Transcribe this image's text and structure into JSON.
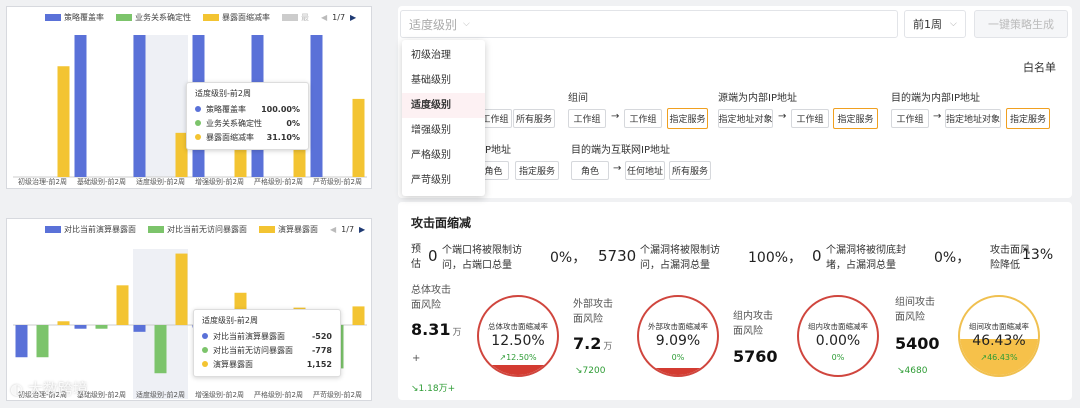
{
  "chart_data": [
    {
      "type": "bar",
      "categories": [
        "初级治理-前2周",
        "基础级别-前2周",
        "适度级别-前2周",
        "增强级别-前2周",
        "严格级别-前2周",
        "严苛级别-前2周"
      ],
      "series": [
        {
          "name": "策略覆盖率",
          "color": "#5a71d8",
          "values": [
            0,
            100,
            100,
            100,
            100,
            100
          ]
        },
        {
          "name": "业务关系确定性",
          "color": "#7cc46b",
          "values": [
            0,
            0,
            0,
            0,
            0,
            0
          ]
        },
        {
          "name": "暴露面缩减率",
          "color": "#f3c432",
          "values": [
            78,
            0,
            31.1,
            48,
            58,
            55
          ]
        }
      ],
      "legend_extra": "最",
      "page": "1/7",
      "tooltip": {
        "title": "适度级别-前2周",
        "rows": [
          {
            "name": "策略覆盖率",
            "value": "100.00%"
          },
          {
            "name": "业务关系确定性",
            "value": "0%"
          },
          {
            "name": "暴露面缩减率",
            "value": "31.10%"
          }
        ]
      }
    },
    {
      "type": "bar",
      "categories": [
        "初级治理-前2周",
        "基础级别-前2周",
        "适度级别-前2周",
        "增强级别-前2周",
        "严格级别-前2周",
        "严苛级别-前2周"
      ],
      "series": [
        {
          "name": "对比当前演算暴露面",
          "color": "#5a71d8",
          "values": [
            -520,
            -60,
            -110,
            -40,
            -50,
            -70
          ]
        },
        {
          "name": "对比当前无访问暴露面",
          "color": "#7cc46b",
          "values": [
            -520,
            -60,
            -778,
            -40,
            -60,
            -700
          ]
        },
        {
          "name": "演算暴露面",
          "color": "#f3c432",
          "values": [
            60,
            640,
            1152,
            520,
            280,
            300
          ]
        }
      ],
      "legend_extra": "",
      "page": "1/7",
      "tooltip": {
        "title": "适度级别-前2周",
        "rows": [
          {
            "name": "对比当前演算暴露面",
            "value": "-520"
          },
          {
            "name": "对比当前无访问暴露面",
            "value": "-778"
          },
          {
            "name": "演算暴露面",
            "value": "1,152"
          }
        ]
      }
    }
  ],
  "toolbar": {
    "level_placeholder": "适度级别",
    "period": "前1周",
    "generate_label": "一键策略生成"
  },
  "dropdown": {
    "items": [
      "初级治理",
      "基础级别",
      "适度级别",
      "增强级别",
      "严格级别",
      "严苛级别"
    ],
    "selected": "适度级别"
  },
  "policy": {
    "whitelist": "白名单",
    "groups": [
      {
        "title": "",
        "chips": [
          {
            "text": "工作组"
          },
          {
            "text": "所有服务"
          }
        ]
      },
      {
        "title": "组间",
        "chips": [
          {
            "text": "工作组"
          },
          {
            "text": "工作组"
          },
          {
            "text": "指定服务",
            "hl": true
          }
        ]
      },
      {
        "title": "源端为内部IP地址",
        "chips": [
          {
            "text": "指定地址对象"
          },
          {
            "text": "工作组"
          },
          {
            "text": "指定服务",
            "hl": true
          }
        ]
      },
      {
        "title": "目的端为内部IP地址",
        "chips": [
          {
            "text": "工作组"
          },
          {
            "text": "指定地址对象"
          },
          {
            "text": "指定服务",
            "hl": true
          }
        ]
      },
      {
        "title": "IP地址",
        "chips": [
          {
            "text": "角色"
          },
          {
            "text": "指定服务"
          }
        ]
      },
      {
        "title": "目的端为互联网IP地址",
        "chips": [
          {
            "text": "角色"
          },
          {
            "text": "任何地址"
          },
          {
            "text": "所有服务"
          }
        ]
      }
    ],
    "arrow": "→"
  },
  "attack": {
    "title": "攻击面缩减",
    "forecast": [
      "预",
      "估"
    ],
    "stats": [
      {
        "num": "0",
        "desc": [
          "个端口将被限制访",
          "问，占端口总量"
        ],
        "pct": "0%，"
      },
      {
        "num": "5730",
        "desc": [
          "个漏洞将被限制访",
          "问，占漏洞总量"
        ],
        "pct": "100%，"
      },
      {
        "num": "0",
        "desc": [
          "个漏洞将被彻底封",
          "堵，占漏洞总量"
        ],
        "pct": "0%，"
      }
    ],
    "drop_label": [
      "攻击面风",
      "险降低"
    ],
    "drop_pct": "13%",
    "kpis": [
      {
        "label": [
          "总体攻击",
          "面风险"
        ],
        "value": "8.31",
        "unit": "万",
        "plus": "+",
        "trend": "↘1.18万+",
        "circle": {
          "title": "总体攻击面缩减率",
          "value": "12.50%",
          "sub": "↗12.50%",
          "fill": 0.125,
          "yellow": false
        }
      },
      {
        "label": [
          "外部攻击",
          "面风险"
        ],
        "value": "7.2",
        "unit": "万",
        "plus": "",
        "trend": "↘7200",
        "circle": {
          "title": "外部攻击面缩减率",
          "value": "9.09%",
          "sub": "0%",
          "fill": 0.0909,
          "yellow": false
        }
      },
      {
        "label": [
          "组内攻击",
          "面风险"
        ],
        "value": "5760",
        "unit": "",
        "plus": "",
        "trend": "",
        "circle": {
          "title": "组内攻击面缩减率",
          "value": "0.00%",
          "sub": "0%",
          "fill": 0,
          "yellow": false
        }
      },
      {
        "label": [
          "组间攻击",
          "面风险"
        ],
        "value": "5400",
        "unit": "",
        "plus": "",
        "trend": "↘4680",
        "circle": {
          "title": "组间攻击面缩减率",
          "value": "46.43%",
          "sub": "↗46.43%",
          "fill": 0.4643,
          "yellow": true
        }
      }
    ]
  },
  "watermark": "大数跨境"
}
